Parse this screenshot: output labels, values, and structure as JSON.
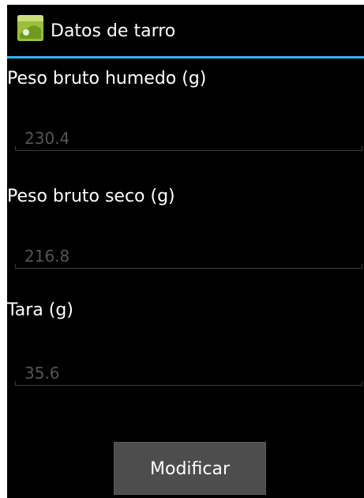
{
  "action_bar": {
    "app_icon": "android-app-icon",
    "title": "Datos de tarro"
  },
  "fields": [
    {
      "label": "Peso bruto humedo (g)",
      "value": "230.4"
    },
    {
      "label": "Peso bruto seco (g)",
      "value": "216.8"
    },
    {
      "label": "Tara (g)",
      "value": "35.6"
    }
  ],
  "button": {
    "label": "Modificar"
  },
  "colors": {
    "background": "#000000",
    "accent": "#33b5e5",
    "text_primary": "#ffffff",
    "text_hint": "#555555",
    "button_bg": "#4d4d4d"
  }
}
